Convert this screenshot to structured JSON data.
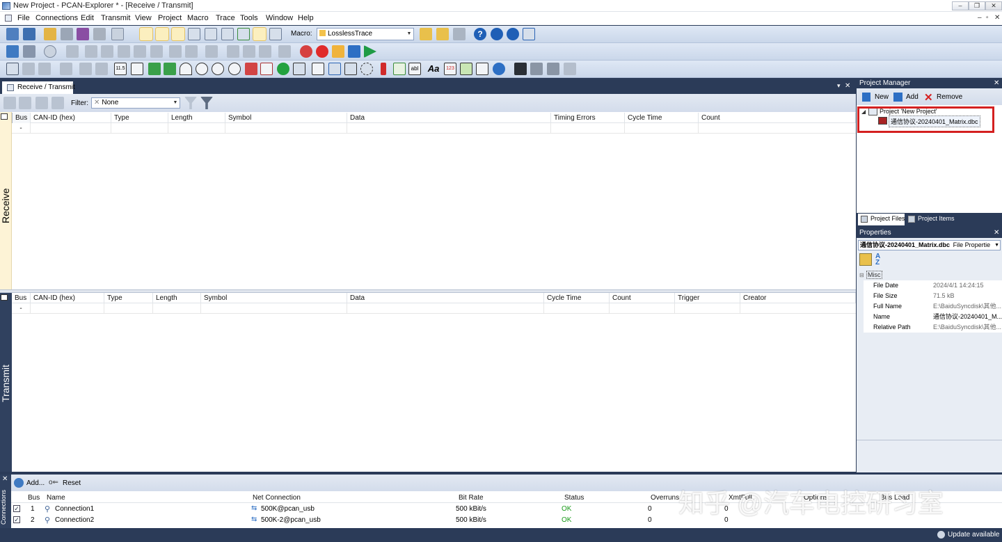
{
  "window": {
    "title": "New Project - PCAN-Explorer * - [Receive / Transmit]",
    "buttons": {
      "minimize": "–",
      "restore": "❐",
      "close": "✕"
    },
    "mdi_buttons": {
      "minimize": "–",
      "restore": "▫",
      "close": "✕"
    }
  },
  "menu": [
    "File",
    "Connections",
    "Edit",
    "Transmit",
    "View",
    "Project",
    "Macro",
    "Trace",
    "Tools",
    "Window",
    "Help"
  ],
  "toolbar": {
    "macro_label": "Macro:",
    "macro_value": "LosslessTrace"
  },
  "doc_tab": {
    "label": "Receive / Transmit",
    "pin": "▾",
    "close": "✕"
  },
  "filter": {
    "label": "Filter:",
    "value": "None"
  },
  "receive": {
    "side_label": "Receive",
    "columns": [
      "Bus",
      "CAN-ID (hex)",
      "Type",
      "Length",
      "Symbol",
      "Data",
      "Timing Errors",
      "Cycle Time",
      "Count"
    ],
    "new_row_marker": "-"
  },
  "transmit": {
    "side_label": "Transmit",
    "columns": [
      "Bus",
      "CAN-ID (hex)",
      "Type",
      "Length",
      "Symbol",
      "Data",
      "Cycle Time",
      "Count",
      "Trigger",
      "Creator"
    ],
    "new_row_marker": "-"
  },
  "project_manager": {
    "title": "Project Manager",
    "close": "✕",
    "new_label": "New",
    "add_label": "Add",
    "remove_label": "Remove",
    "tree_root": "Project 'New Project'",
    "tree_file": "通信协议-20240401_Matrix.dbc",
    "tabs": [
      "Project Files",
      "Project Items"
    ]
  },
  "properties": {
    "title": "Properties",
    "close": "✕",
    "selector_name": "通信协议-20240401_Matrix.dbc",
    "selector_type": "File Propertie",
    "category": "Misc",
    "rows": [
      {
        "name": "File Date",
        "value": "2024/4/1 14:24:15"
      },
      {
        "name": "File Size",
        "value": "71.5 kB"
      },
      {
        "name": "Full Name",
        "value": "E:\\BaiduSyncdisk\\其他..."
      },
      {
        "name": "Name",
        "value": "通信协议-20240401_M..."
      },
      {
        "name": "Relative Path",
        "value": "E:\\BaiduSyncdisk\\其他..."
      }
    ]
  },
  "connections": {
    "side_label": "Connections",
    "add_label": "Add...",
    "reset_label": "Reset",
    "columns": [
      "Bus",
      "Name",
      "Net Connection",
      "Bit Rate",
      "Status",
      "Overruns",
      "XmtFull",
      "Options",
      "Bus Load"
    ],
    "rows": [
      {
        "bus": "1",
        "name": "Connection1",
        "net": "500K@pcan_usb",
        "bitrate": "500 kBit/s",
        "status": "OK",
        "overruns": "0",
        "xmtfull": "0"
      },
      {
        "bus": "2",
        "name": "Connection2",
        "net": "500K-2@pcan_usb",
        "bitrate": "500 kBit/s",
        "status": "OK",
        "overruns": "0",
        "xmtfull": "0"
      }
    ]
  },
  "statusbar": {
    "update_label": "Update available"
  },
  "watermark": "知乎 @汽车电控研习室",
  "colors": {
    "accent": "#2b3b58",
    "side_panel": "#fdf3d6",
    "ok": "#1a9a1a",
    "highlight_box": "#d42020"
  }
}
